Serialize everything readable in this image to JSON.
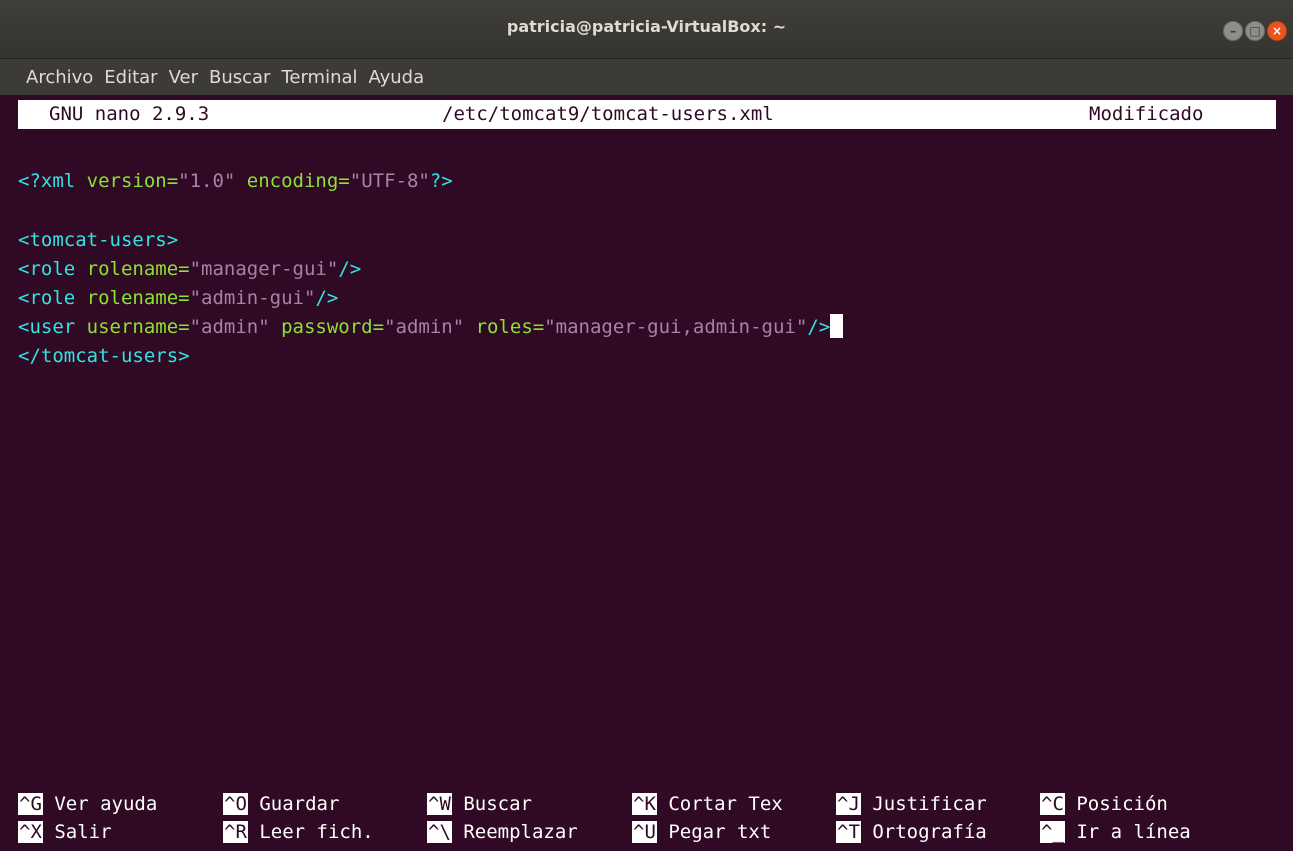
{
  "window": {
    "title": "patricia@patricia-VirtualBox: ~",
    "close_glyph": "×",
    "min_glyph": "–",
    "max_glyph": "□"
  },
  "menubar": {
    "items": [
      "Archivo",
      "Editar",
      "Ver",
      "Buscar",
      "Terminal",
      "Ayuda"
    ]
  },
  "nano": {
    "version": "GNU nano 2.9.3",
    "filename": "/etc/tomcat9/tomcat-users.xml",
    "status": "Modificado"
  },
  "editor": {
    "line1": {
      "open": "<?xml",
      "attr1": " version=",
      "val1": "\"1.0\"",
      "attr2": " encoding=",
      "val2": "\"UTF-8\"",
      "close": "?>"
    },
    "line2": {
      "tag": "<tomcat-users>"
    },
    "line3": {
      "open": "<role",
      "attr": " rolename=",
      "val": "\"manager-gui\"",
      "close": "/>"
    },
    "line4": {
      "open": "<role",
      "attr": " rolename=",
      "val": "\"admin-gui\"",
      "close": "/>"
    },
    "line5": {
      "open": "<user",
      "attr1": " username=",
      "val1": "\"admin\"",
      "attr2": " password=",
      "val2": "\"admin\"",
      "attr3": " roles=",
      "val3": "\"manager-gui,admin-gui\"",
      "close": "/>"
    },
    "line6": {
      "tag": "</tomcat-users>"
    }
  },
  "shortcuts": {
    "row1": [
      {
        "key": "^G",
        "label": "Ver ayuda"
      },
      {
        "key": "^O",
        "label": "Guardar"
      },
      {
        "key": "^W",
        "label": "Buscar"
      },
      {
        "key": "^K",
        "label": "Cortar Tex"
      },
      {
        "key": "^J",
        "label": "Justificar"
      },
      {
        "key": "^C",
        "label": "Posición"
      }
    ],
    "row2": [
      {
        "key": "^X",
        "label": "Salir"
      },
      {
        "key": "^R",
        "label": "Leer fich."
      },
      {
        "key": "^\\",
        "label": "Reemplazar"
      },
      {
        "key": "^U",
        "label": "Pegar txt"
      },
      {
        "key": "^T",
        "label": "Ortografía"
      },
      {
        "key": "^_",
        "label": "Ir a línea"
      }
    ]
  },
  "colors": {
    "background": "#300a24",
    "tag": "#34e2e2",
    "attribute": "#8ae234",
    "string": "#ad7fa8"
  }
}
